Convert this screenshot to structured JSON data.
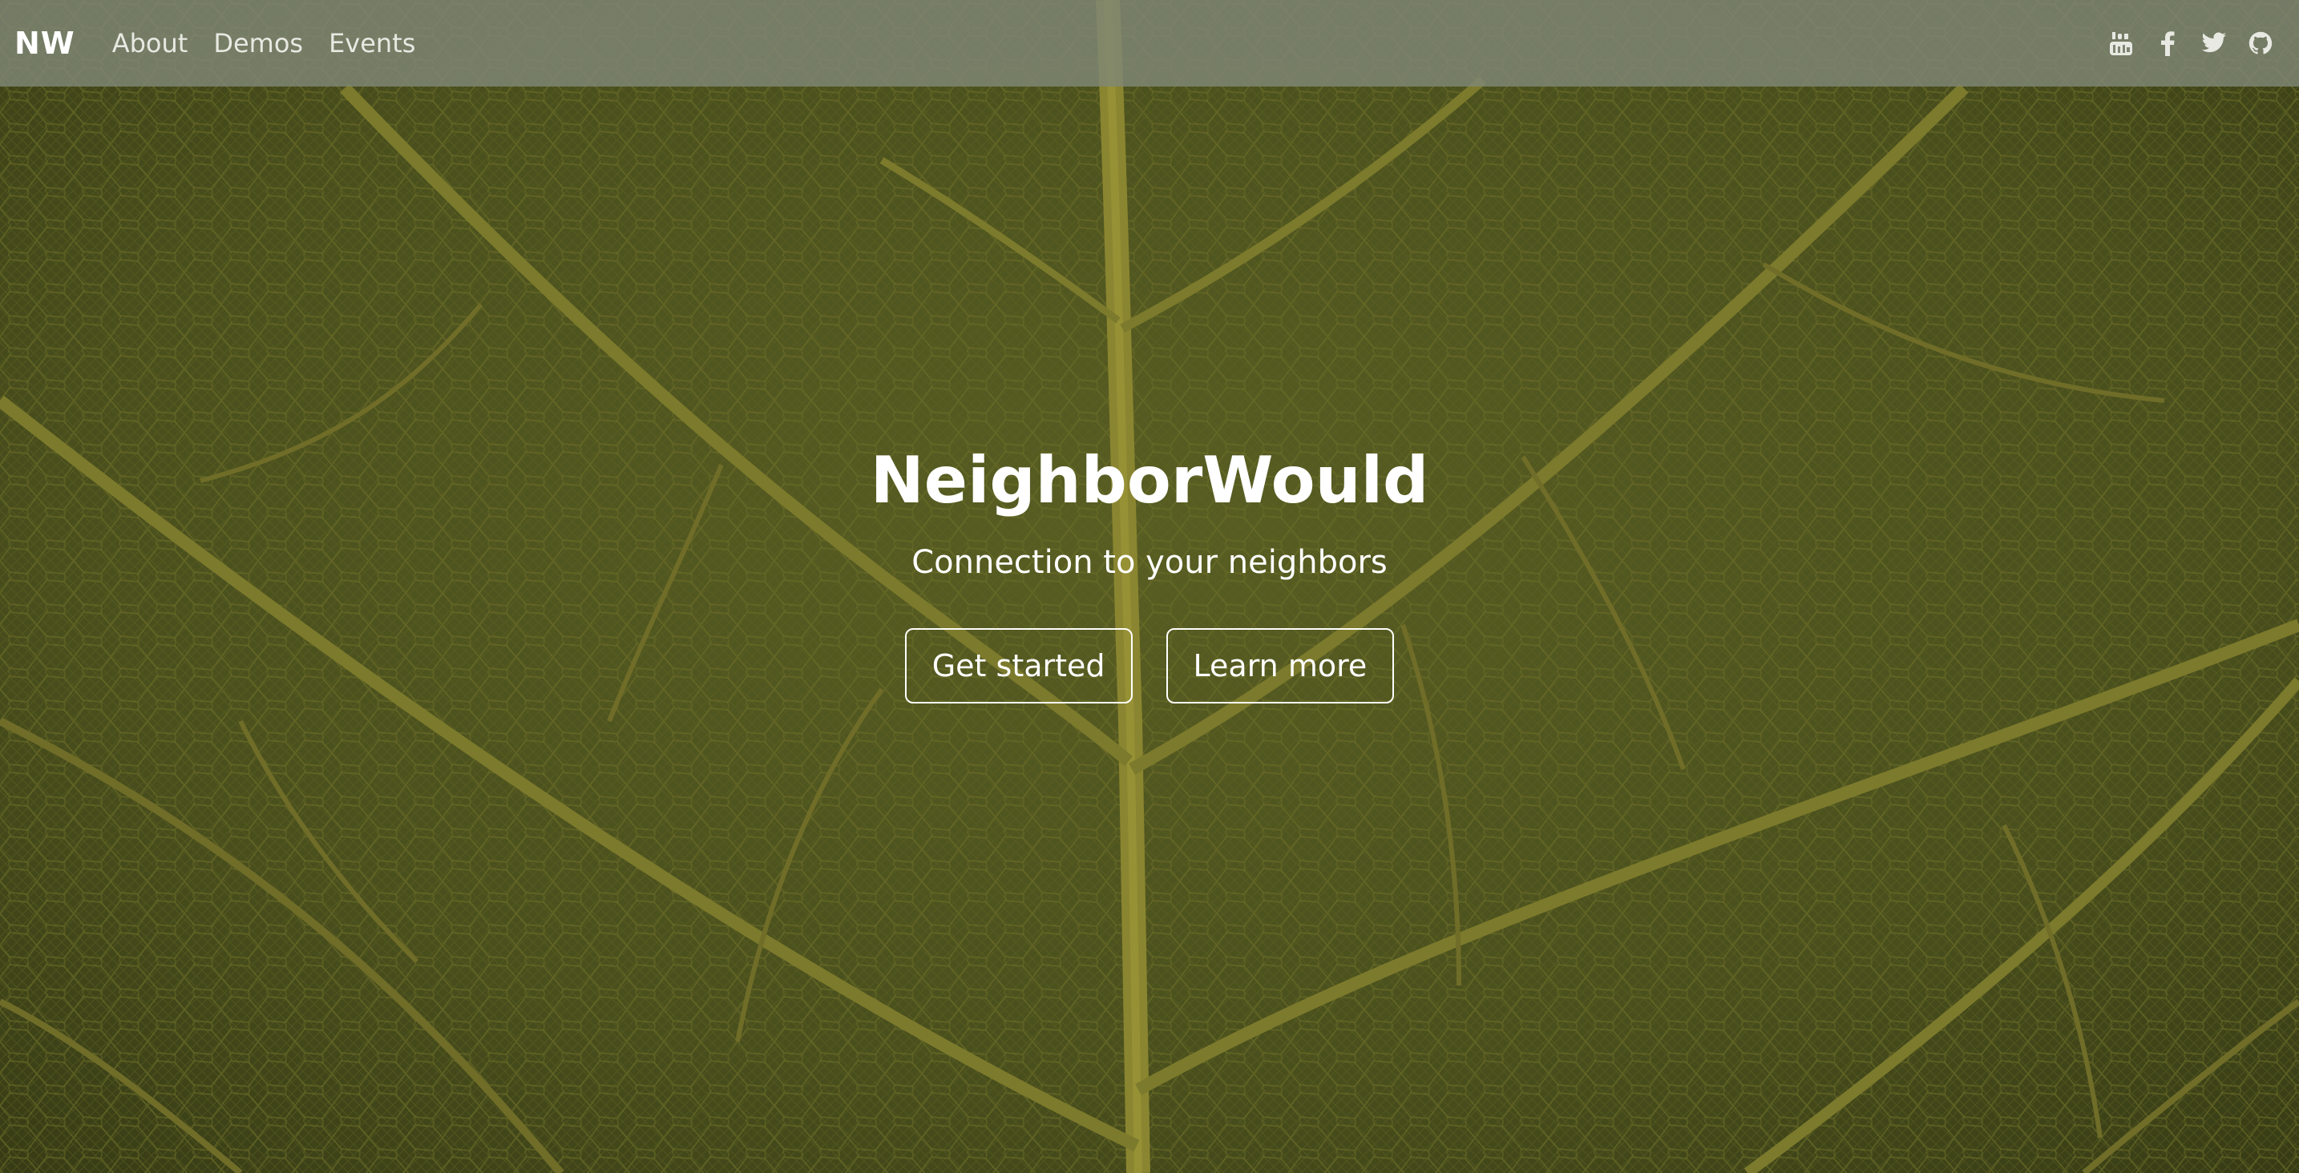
{
  "navbar": {
    "brand": "NW",
    "links": [
      {
        "label": "About"
      },
      {
        "label": "Demos"
      },
      {
        "label": "Events"
      }
    ],
    "social": [
      {
        "icon": "youtube-icon"
      },
      {
        "icon": "facebook-icon"
      },
      {
        "icon": "twitter-icon"
      },
      {
        "icon": "github-icon"
      }
    ]
  },
  "hero": {
    "title": "NeighborWould",
    "subtitle": "Connection to your neighbors",
    "primary_button": "Get started",
    "secondary_button": "Learn more",
    "background": "leaf-vein-photo"
  },
  "colors": {
    "leaf_dark": "#3e4318",
    "leaf_vein": "#7c7a2c",
    "navbar_bg": "#7f8574",
    "text": "#ffffff"
  }
}
